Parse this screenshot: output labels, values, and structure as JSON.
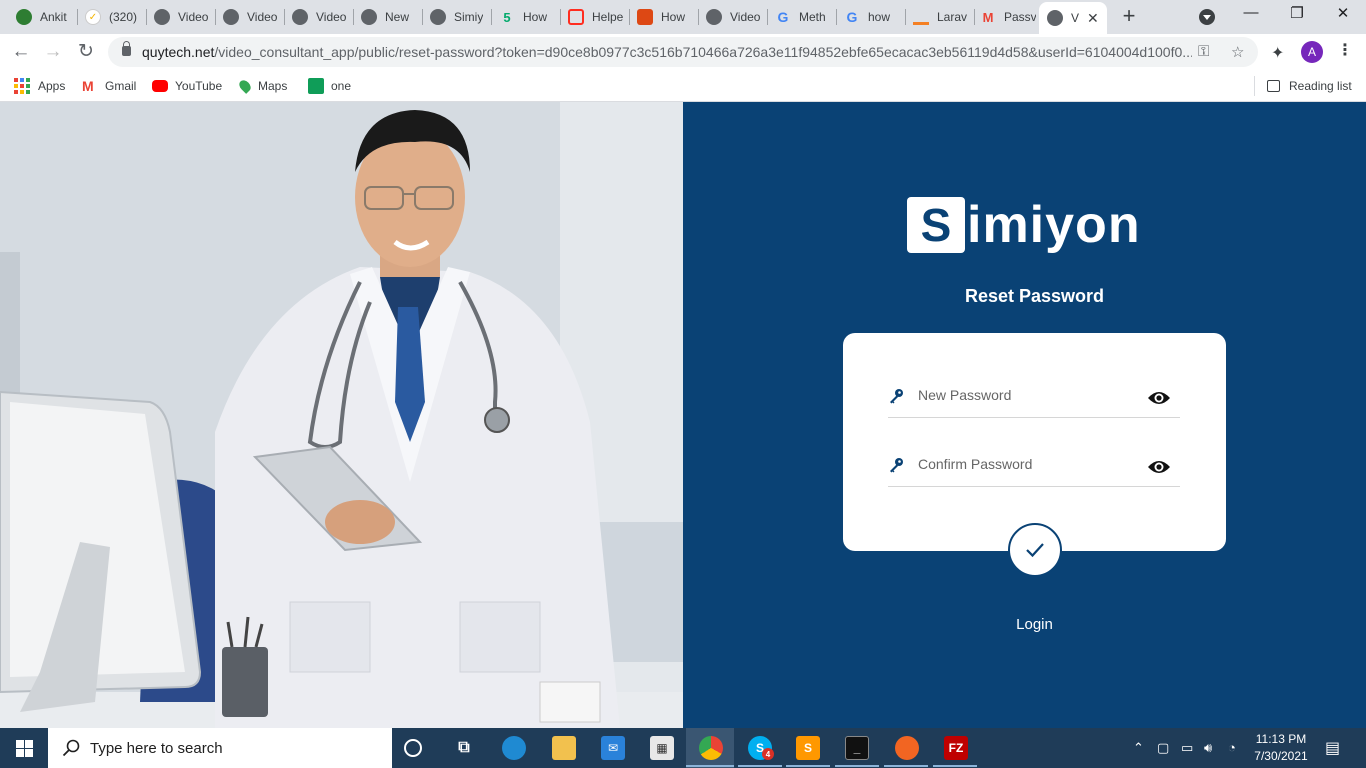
{
  "browser": {
    "tabs": [
      {
        "label": "Ankit",
        "icon": "globe-green-icon",
        "color": "#2e7d32"
      },
      {
        "label": "(320)",
        "icon": "check-icon",
        "color": "#f4b400"
      },
      {
        "label": "Video",
        "icon": "globe-icon",
        "color": "#5f6368"
      },
      {
        "label": "Video",
        "icon": "globe-icon",
        "color": "#5f6368"
      },
      {
        "label": "Video",
        "icon": "globe-icon",
        "color": "#5f6368"
      },
      {
        "label": "New",
        "icon": "globe-icon",
        "color": "#5f6368"
      },
      {
        "label": "Simiy",
        "icon": "globe-icon",
        "color": "#5f6368"
      },
      {
        "label": "How",
        "icon": "w3-icon",
        "color": "#04aa6d"
      },
      {
        "label": "Helpe",
        "icon": "laravel-icon",
        "color": "#ff2d20"
      },
      {
        "label": "How",
        "icon": "codeigniter-icon",
        "color": "#dd4814"
      },
      {
        "label": "Video",
        "icon": "globe-icon",
        "color": "#5f6368"
      },
      {
        "label": "Meth",
        "icon": "google-icon",
        "color": "#4285f4"
      },
      {
        "label": "how",
        "icon": "google-icon",
        "color": "#4285f4"
      },
      {
        "label": "Larav",
        "icon": "stackoverflow-icon",
        "color": "#f48024"
      },
      {
        "label": "Passv",
        "icon": "gmail-icon",
        "color": "#ea4335"
      },
      {
        "label": "V",
        "icon": "globe-icon",
        "color": "#5f6368",
        "active": true
      }
    ],
    "url_host": "quytech.net",
    "url_rest": "/video_consultant_app/public/reset-password?token=d90ce8b0977c3c516b710466a726a3e11f94852ebfe65ecacac3eb56119d4d58&userId=6104004d100f0...",
    "profile_initial": "A",
    "bookmarks": [
      {
        "label": "Apps"
      },
      {
        "label": "Gmail"
      },
      {
        "label": "YouTube"
      },
      {
        "label": "Maps"
      },
      {
        "label": "one"
      }
    ],
    "reading_list": "Reading list"
  },
  "page": {
    "logo_letter": "S",
    "logo_text": "imiyon",
    "heading": "Reset Password",
    "new_password_placeholder": "New Password",
    "confirm_password_placeholder": "Confirm Password",
    "login_link": "Login",
    "colors": {
      "panel": "#0a4275",
      "card": "#ffffff"
    }
  },
  "taskbar": {
    "search_placeholder": "Type here to search",
    "time": "11:13 PM",
    "date": "7/30/2021",
    "skype_badge": "4"
  }
}
